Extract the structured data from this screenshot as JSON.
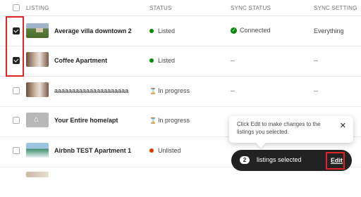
{
  "header": {
    "listing": "LISTING",
    "status": "STATUS",
    "sync_status": "SYNC STATUS",
    "sync_setting": "SYNC SETTING"
  },
  "rows": [
    {
      "title": "Average villa downtown 2",
      "status": "Listed",
      "status_color": "#008a05",
      "sync": "Connected",
      "sync_icon": "check-circle-icon",
      "setting": "Everything",
      "checked": true,
      "thumb": "villa"
    },
    {
      "title": "Coffee Apartment",
      "status": "Listed",
      "status_color": "#008a05",
      "sync": "--",
      "setting": "--",
      "checked": true,
      "thumb": "room"
    },
    {
      "title": "aaaaaaaaaaaaaaaaaaaaa",
      "status": "In progress",
      "status_icon": "hourglass-icon",
      "sync": "--",
      "setting": "--",
      "checked": false,
      "thumb": "room"
    },
    {
      "title": "Your Entire home/apt",
      "status": "In progress",
      "status_icon": "hourglass-icon",
      "checked": false,
      "thumb": "placeholder-home"
    },
    {
      "title": "Airbnb TEST Apartment 1",
      "status": "Unlisted",
      "status_color": "#d93900",
      "checked": false,
      "thumb": "apartment"
    }
  ],
  "popover": {
    "text": "Click Edit to make changes to the listings you selected.",
    "close_icon": "close-icon"
  },
  "selection_bar": {
    "count": "2",
    "label": "listings selected",
    "edit": "Edit"
  },
  "colors": {
    "highlight": "#e02424",
    "listed": "#008a05",
    "unlisted": "#d93900",
    "bar": "#222222"
  }
}
